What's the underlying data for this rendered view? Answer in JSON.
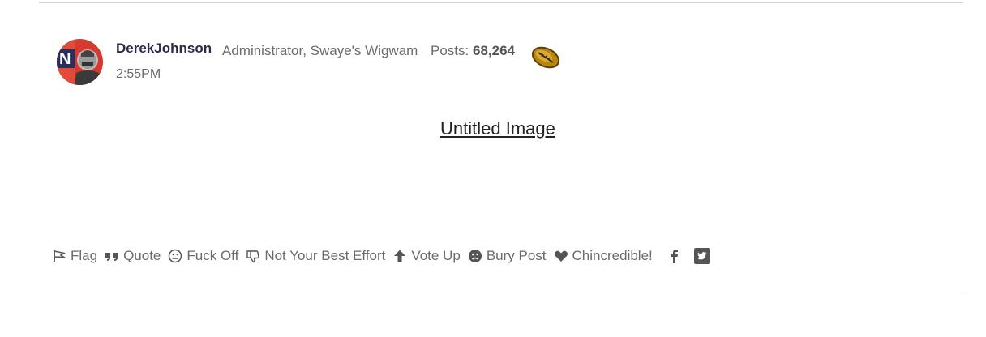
{
  "post": {
    "username": "DerekJohnson",
    "role": "Administrator, Swaye's Wigwam",
    "posts_label": "Posts:",
    "posts_count": "68,264",
    "time": "2:55PM",
    "badge_icon": "football-icon",
    "avatar_icon": "user-avatar"
  },
  "body": {
    "image_link": "Untitled Image"
  },
  "actions": [
    {
      "label": "Flag",
      "icon": "flag-icon"
    },
    {
      "label": "Quote",
      "icon": "quote-icon"
    },
    {
      "label": "Fuck Off",
      "icon": "neutral-face-icon"
    },
    {
      "label": "Not Your Best Effort",
      "icon": "thumbs-down-icon"
    },
    {
      "label": "Vote Up",
      "icon": "arrow-up-icon"
    },
    {
      "label": "Bury Post",
      "icon": "sad-face-icon"
    },
    {
      "label": "Chincredible!",
      "icon": "heart-icon"
    }
  ],
  "share": {
    "facebook_icon": "facebook-icon",
    "twitter_icon": "twitter-icon"
  },
  "colors": {
    "username": "#2d2a4a",
    "meta_text": "#6b6b6b",
    "divider": "#d6d6d6",
    "avatar_red": "#d43a2f",
    "avatar_navy": "#2a2e5c"
  }
}
